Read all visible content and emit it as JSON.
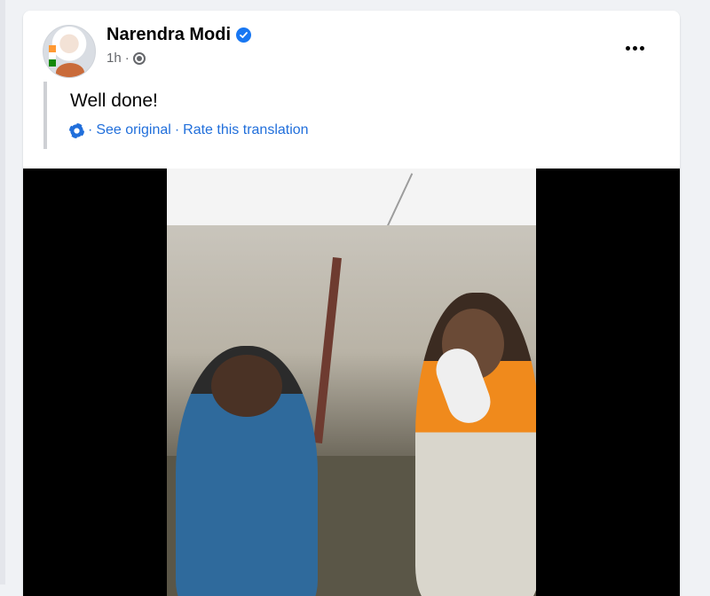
{
  "post": {
    "author": "Narendra Modi",
    "time": "1h",
    "separator": "·",
    "text": "Well done!",
    "translation": {
      "see_original": "See original",
      "rate": "Rate this translation",
      "sep1": "·",
      "sep2": "·"
    }
  },
  "icons": {
    "verified": "verified-badge",
    "audience": "globe-icon",
    "translation": "gear-icon",
    "more": "more-options-icon"
  },
  "colors": {
    "link": "#216fdb",
    "verified": "#1877f2",
    "text": "#050505",
    "secondary": "#65676b",
    "background": "#f0f2f5"
  }
}
